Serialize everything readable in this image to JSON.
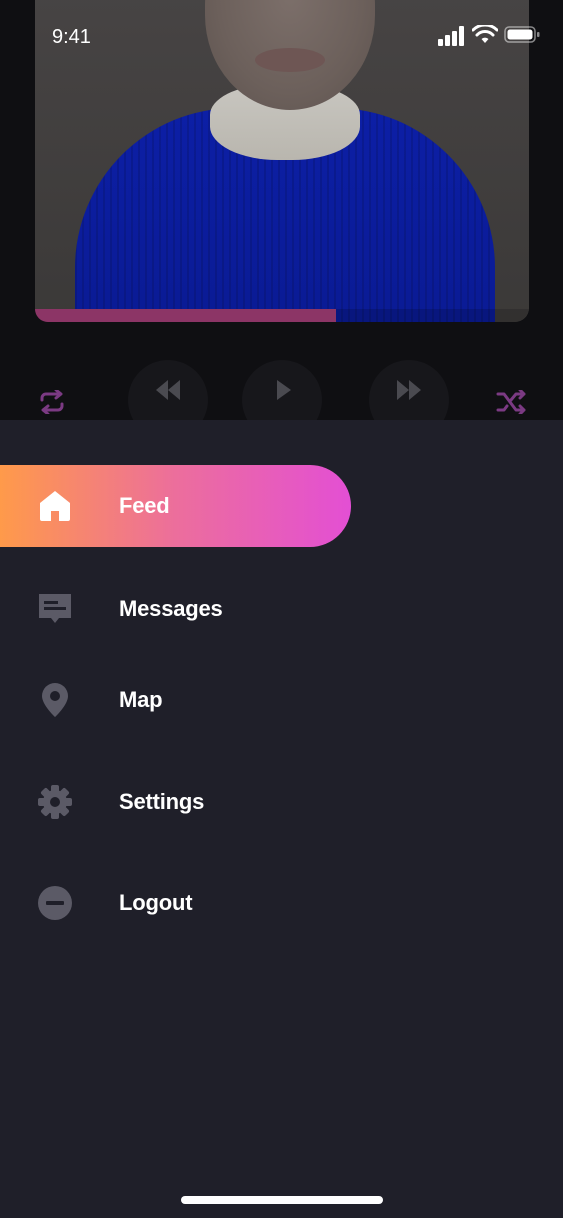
{
  "status_bar": {
    "time": "9:41"
  },
  "player": {
    "progress": 0.61,
    "controls": [
      {
        "icon": "repeat-icon"
      },
      {
        "icon": "rewind-icon"
      },
      {
        "icon": "play-icon"
      },
      {
        "icon": "fast-forward-icon"
      },
      {
        "icon": "shuffle-icon"
      }
    ]
  },
  "menu": {
    "items": [
      {
        "label": "Feed",
        "icon": "home-icon",
        "active": true
      },
      {
        "label": "Messages",
        "icon": "message-icon",
        "active": false
      },
      {
        "label": "Map",
        "icon": "location-pin-icon",
        "active": false
      },
      {
        "label": "Settings",
        "icon": "gear-icon",
        "active": false
      },
      {
        "label": "Logout",
        "icon": "minus-circle-icon",
        "active": false
      }
    ]
  },
  "colors": {
    "drawer_bg": "#1f1f29",
    "active_gradient": [
      "#ff9a4a",
      "#e34fd4"
    ],
    "icon_inactive": "#5b5a66",
    "control_accent": "#7b3a83"
  }
}
